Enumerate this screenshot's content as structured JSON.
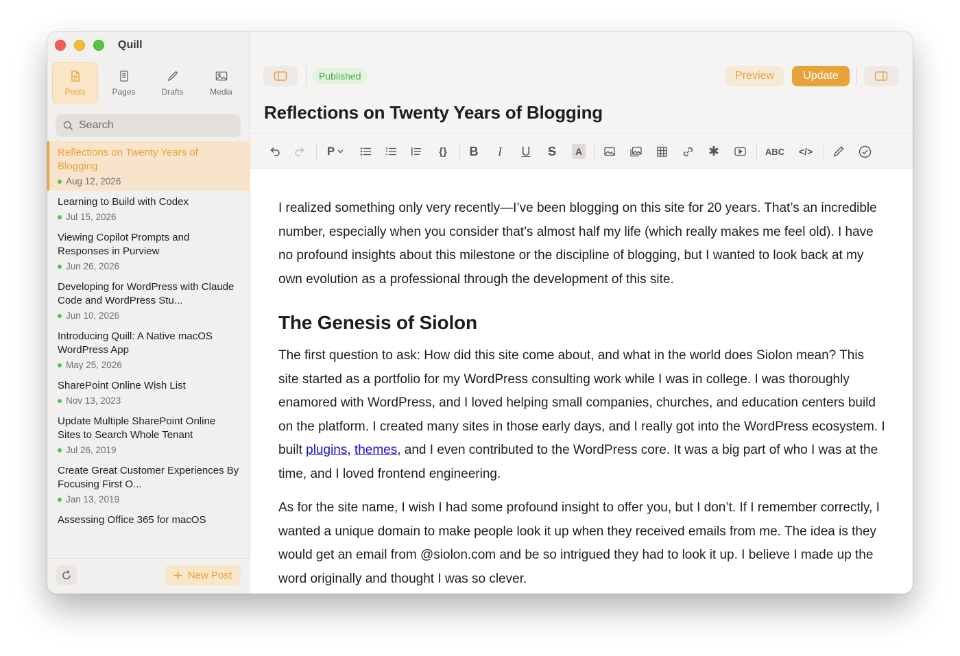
{
  "app": {
    "title": "Quill"
  },
  "tabs": [
    {
      "label": "Posts",
      "icon": "document-icon",
      "active": true
    },
    {
      "label": "Pages",
      "icon": "page-icon",
      "active": false
    },
    {
      "label": "Drafts",
      "icon": "pencil-icon",
      "active": false
    },
    {
      "label": "Media",
      "icon": "photo-icon",
      "active": false
    }
  ],
  "search": {
    "placeholder": "Search"
  },
  "posts": [
    {
      "title": "Reflections on Twenty Years of Blogging",
      "date": "Aug 12, 2026",
      "status": "published",
      "active": true
    },
    {
      "title": "Learning to Build with Codex",
      "date": "Jul 15, 2026",
      "status": "published"
    },
    {
      "title": "Viewing Copilot Prompts and Responses in Purview",
      "date": "Jun 26, 2026",
      "status": "published"
    },
    {
      "title": "Developing for WordPress with Claude Code and WordPress Stu...",
      "date": "Jun 10, 2026",
      "status": "published"
    },
    {
      "title": "Introducing Quill: A Native macOS WordPress App",
      "date": "May 25, 2026",
      "status": "published"
    },
    {
      "title": "SharePoint Online Wish List",
      "date": "Nov 13, 2023",
      "status": "published"
    },
    {
      "title": "Update Multiple SharePoint Online Sites to Search Whole Tenant",
      "date": "Jul 26, 2019",
      "status": "published"
    },
    {
      "title": "Create Great Customer Experiences By Focusing First O...",
      "date": "Jan 13, 2019",
      "status": "published"
    },
    {
      "title": "Assessing Office 365 for macOS",
      "date": "",
      "status": "published"
    }
  ],
  "sidebar_footer": {
    "new_post_label": "New Post",
    "new_post_icon": "plus-icon",
    "refresh_icon": "refresh-icon"
  },
  "editor": {
    "status_badge": "Published",
    "preview_label": "Preview",
    "update_label": "Update",
    "title": "Reflections on Twenty Years of Blogging",
    "format_block": "P",
    "toolbar_text": {
      "spellcheck": "ABC",
      "code": "</>"
    }
  },
  "colors": {
    "accent": "#e8a23a",
    "published": "#4cc25b",
    "link": "#1a0dcc"
  },
  "content": {
    "p1": "I realized something only very recently—I’ve been blogging on this site for 20 years. That’s an incredible number, especially when you consider that’s almost half my life (which really makes me feel old). I have no profound insights about this milestone or the discipline of blogging, but I wanted to look back at my own evolution as a professional through the development of this site.",
    "h2": "The Genesis of Siolon",
    "p2_a": "The first question to ask: How did this site come about, and what in the world does Siolon mean? This site started as a portfolio for my WordPress consulting work while I was in college. I was thoroughly enamored with WordPress, and I loved helping small companies, churches, and education centers build on the platform. I created many sites in those early days, and I really got into the WordPress ecosystem. I built ",
    "p2_link1": "plugins",
    "p2_comma": ", ",
    "p2_link2": "themes",
    "p2_b": ", and I even contributed to the WordPress core. It was a big part of who I was at the time, and I loved frontend engineering.",
    "p3": "As for the site name, I wish I had some profound insight to offer you, but I don’t. If I remember correctly, I wanted a unique domain to make people look it up when they received emails from me. The idea is they would get an email from @siolon.com and be so intrigued they had to look it up. I believe I made up the word originally and thought I was so clever."
  }
}
